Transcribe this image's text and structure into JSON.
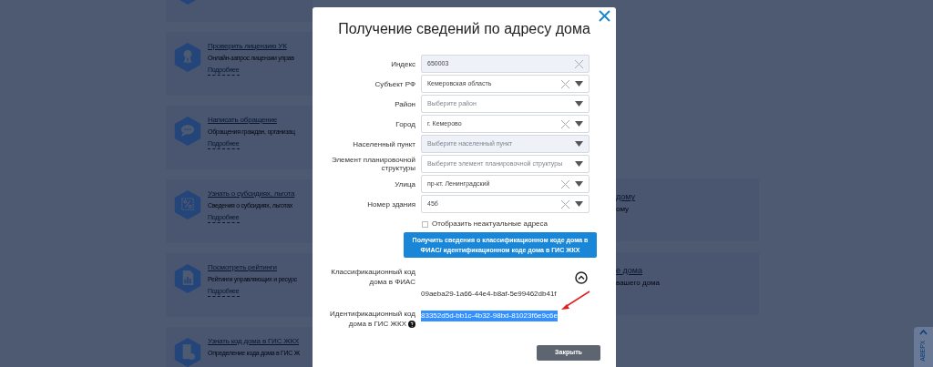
{
  "background_cards": {
    "left": [
      {
        "title": "Проверить лицензию УК",
        "subtitle": "Онлайн-запрос лицензии управ",
        "link": "Подробнее"
      },
      {
        "title": "Написать обращение",
        "subtitle": "Обращения граждан, организац",
        "link": "Подробнее"
      },
      {
        "title": "Узнать о субсидиях, льгота",
        "subtitle": "Сведения о субсидиях, льготах",
        "link": "Подробнее"
      },
      {
        "title": "Посмотреть рейтинги",
        "subtitle": "Рейтинги управляющих и ресурс",
        "link": "Подробнее"
      },
      {
        "title": "Узнать код дома в ГИС ЖКХ",
        "subtitle": "Определение кода дома в ГИС Ж"
      }
    ],
    "right": [
      {
        "title": "дому",
        "subtitle": "ому"
      },
      {
        "title": "е дома",
        "subtitle": "вашего дома"
      }
    ]
  },
  "modal": {
    "title": "Получение сведений по адресу дома",
    "fields": [
      {
        "label": "Индекс",
        "kind": "text",
        "value": "650003",
        "disabled": true,
        "clearable": true
      },
      {
        "label": "Субъект РФ",
        "kind": "select",
        "value": "Кемеровская область",
        "disabled": false,
        "clearable": true
      },
      {
        "label": "Район",
        "kind": "select",
        "placeholder": "Выберите район",
        "disabled": false,
        "clearable": false
      },
      {
        "label": "Город",
        "kind": "select",
        "value": "г. Кемерово",
        "disabled": false,
        "clearable": true
      },
      {
        "label": "Населенный пункт",
        "kind": "select",
        "placeholder": "Выберите населенный пункт",
        "disabled": true,
        "clearable": false
      },
      {
        "label": "Элемент планировочной структуры",
        "kind": "select",
        "placeholder": "Выберите элемент планировочной структуры",
        "disabled": false,
        "clearable": false
      },
      {
        "label": "Улица",
        "kind": "select",
        "value": "пр-кт. Ленинградский",
        "disabled": false,
        "clearable": true
      },
      {
        "label": "Номер здания",
        "kind": "select",
        "value": "45б",
        "disabled": false,
        "clearable": true
      }
    ],
    "checkbox": {
      "label": "Отобразить неактуальные адреса",
      "checked": false
    },
    "submit_button": "Получить сведения о классификационном коде дома в ФИАС/ идентификационном коде дома в ГИС ЖКХ",
    "results": [
      {
        "label": "Классификационный код дома в ФИАС",
        "value": "09aeba29-1a66-44e4-b8af-5e99462db41f",
        "selected": false,
        "help": false
      },
      {
        "label": "Идентификационный код дома в ГИС ЖКХ",
        "value": "83352d5d-bb1c-4b32-98bd-81023f6e9c6e",
        "selected": true,
        "help": true
      }
    ],
    "close_button": "Закрыть"
  },
  "scroll_top": {
    "label": "АВЕРХ"
  }
}
